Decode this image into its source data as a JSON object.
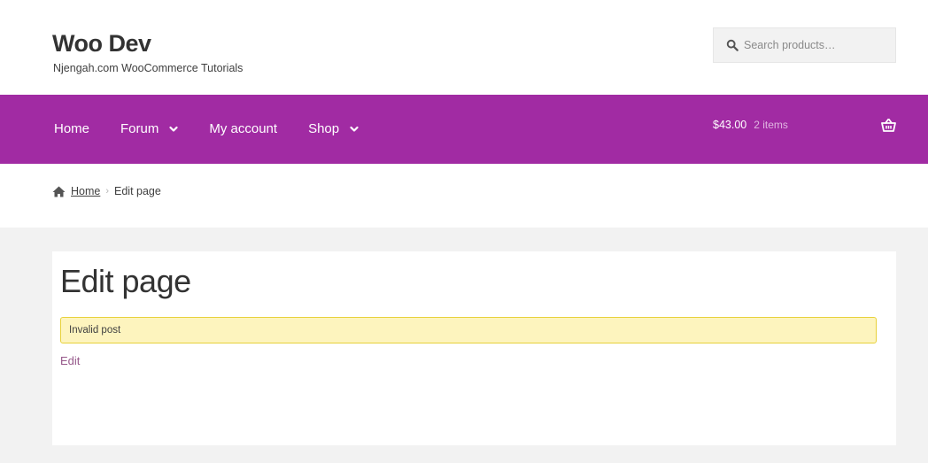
{
  "header": {
    "site_title": "Woo Dev",
    "tagline": "Njengah.com WooCommerce Tutorials",
    "search": {
      "placeholder": "Search products…",
      "icon": "search-icon"
    }
  },
  "nav": {
    "items": [
      {
        "label": "Home",
        "has_dropdown": false
      },
      {
        "label": "Forum",
        "has_dropdown": true
      },
      {
        "label": "My account",
        "has_dropdown": false
      },
      {
        "label": "Shop",
        "has_dropdown": true
      }
    ],
    "cart": {
      "amount": "$43.00",
      "count": "2 items",
      "icon": "basket-icon"
    },
    "background_color": "#a12ba3"
  },
  "breadcrumb": {
    "home_label": "Home",
    "current": "Edit page",
    "separator": "›"
  },
  "main": {
    "page_title": "Edit page",
    "notice": "Invalid post",
    "edit_link": "Edit"
  },
  "colors": {
    "accent": "#a12ba3",
    "link": "#96588a",
    "notice_bg": "#fdf4be",
    "notice_border": "#e7d13a"
  }
}
